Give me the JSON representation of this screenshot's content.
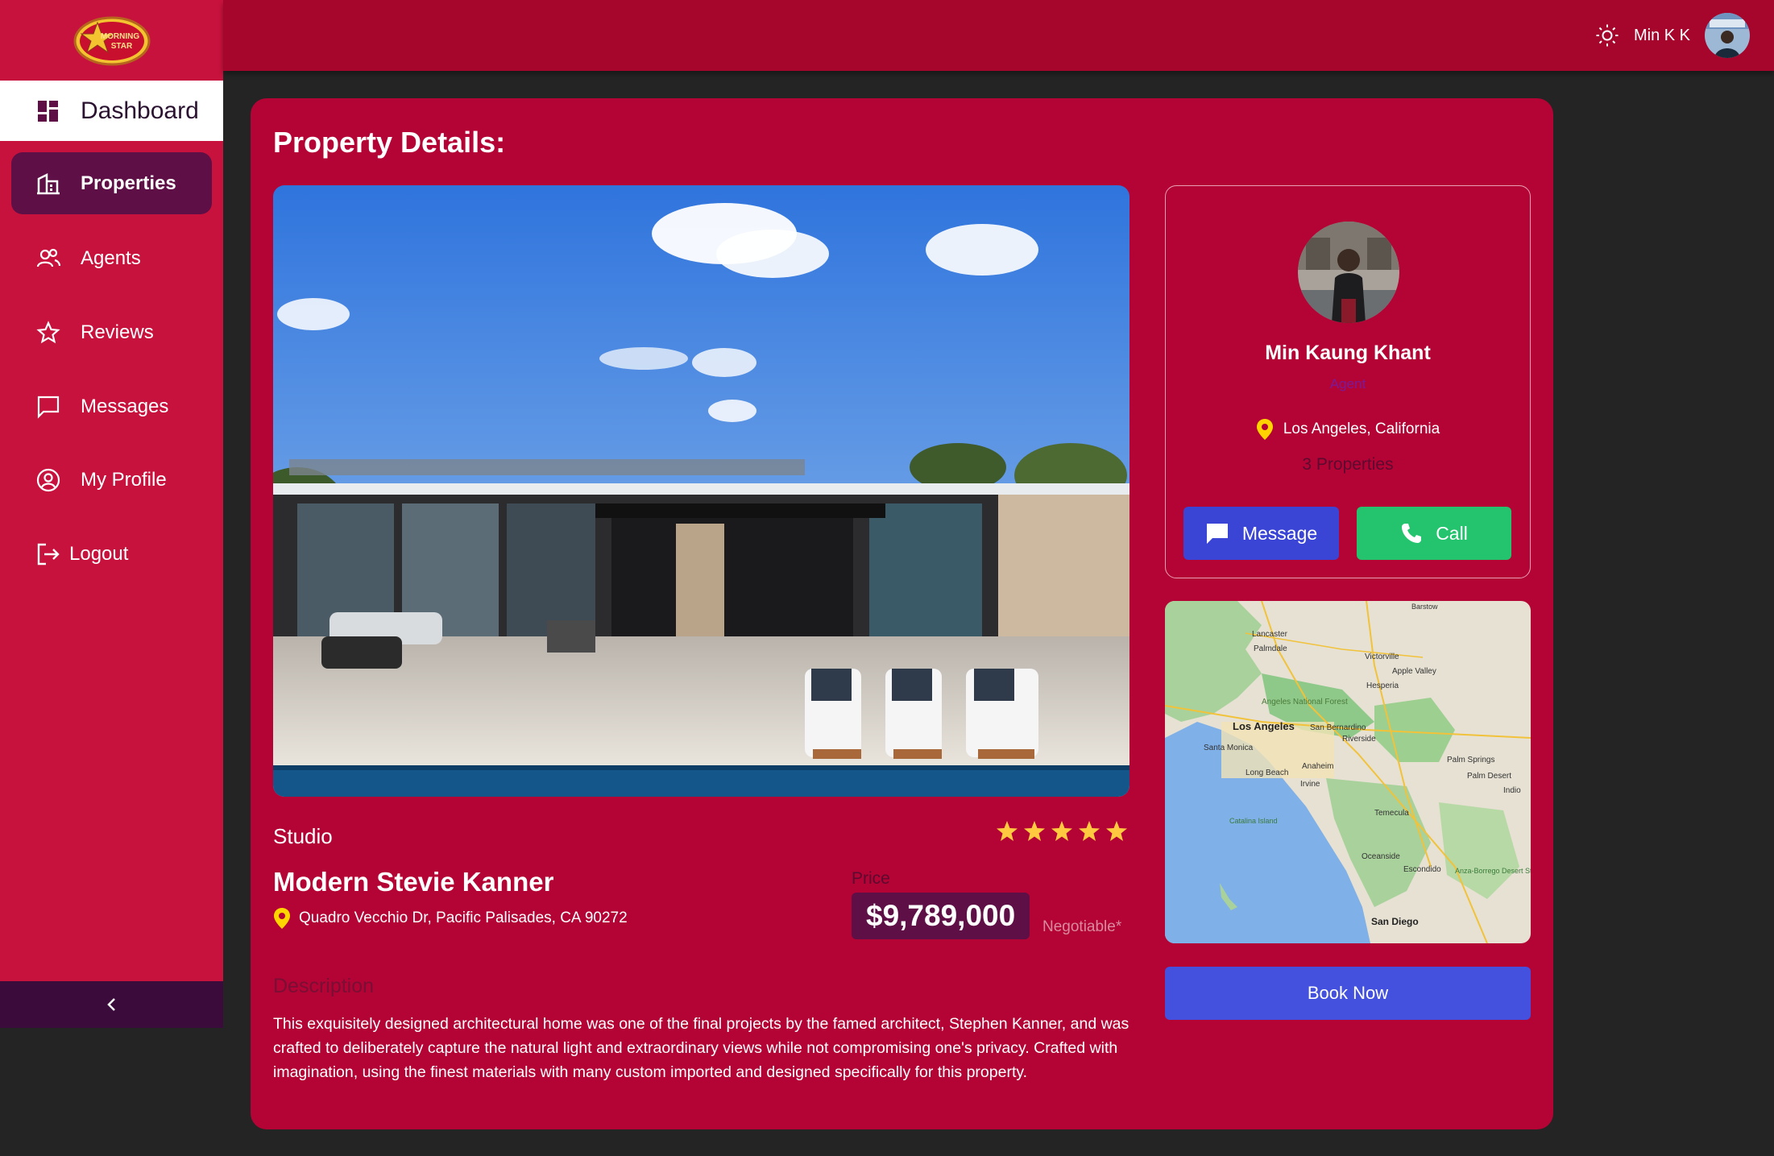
{
  "brand": {
    "logo_text_1": "MORNING",
    "logo_text_2": "STAR"
  },
  "sidebar": {
    "items": [
      {
        "label": "Dashboard",
        "icon": "dashboard-icon"
      },
      {
        "label": "Properties",
        "icon": "building-icon"
      },
      {
        "label": "Agents",
        "icon": "people-icon"
      },
      {
        "label": "Reviews",
        "icon": "star-icon"
      },
      {
        "label": "Messages",
        "icon": "chat-icon"
      },
      {
        "label": "My Profile",
        "icon": "user-circle-icon"
      },
      {
        "label": "Logout",
        "icon": "logout-icon"
      }
    ],
    "active": "Properties",
    "collapse_icon": "chevron-left-icon"
  },
  "topbar": {
    "theme_icon": "sun-icon",
    "username": "Min K K"
  },
  "page": {
    "title": "Property Details:"
  },
  "property": {
    "type": "Studio",
    "rating": 5,
    "title": "Modern Stevie Kanner",
    "address": "Quadro Vecchio Dr, Pacific Palisades, CA 90272",
    "price_label": "Price",
    "price": "$9,789,000",
    "negotiable": "Negotiable*",
    "description_label": "Description",
    "description": "This exquisitely designed architectural home was one of the final projects by the famed architect, Stephen Kanner, and was crafted to deliberately capture the natural light and extraordinary views while not compromising one's privacy. Crafted with imagination, using the finest materials with many custom imported and designed specifically for this property."
  },
  "agent": {
    "name": "Min Kaung Khant",
    "role": "Agent",
    "location": "Los Angeles, California",
    "properties": "3 Properties",
    "message_label": "Message",
    "call_label": "Call"
  },
  "map": {
    "labels": [
      "Lancaster",
      "Palmdale",
      "Victorville",
      "Apple Valley",
      "Hesperia",
      "Angeles National Forest",
      "Los Angeles",
      "Santa Monica",
      "San Bernardino",
      "Riverside",
      "Long Beach",
      "Anaheim",
      "Irvine",
      "Palm Springs",
      "Palm Desert",
      "Indio",
      "Temecula",
      "Oceanside",
      "Escondido",
      "San Diego",
      "Catalina Island",
      "Anza-Borrego Desert State Park",
      "Barstow"
    ]
  },
  "book_label": "Book Now",
  "colors": {
    "primary": "#c8123e",
    "card": "#b30435",
    "purple": "#5e0f46",
    "blue": "#3a45d6",
    "green": "#23c46d",
    "pin": "#ffd400"
  }
}
